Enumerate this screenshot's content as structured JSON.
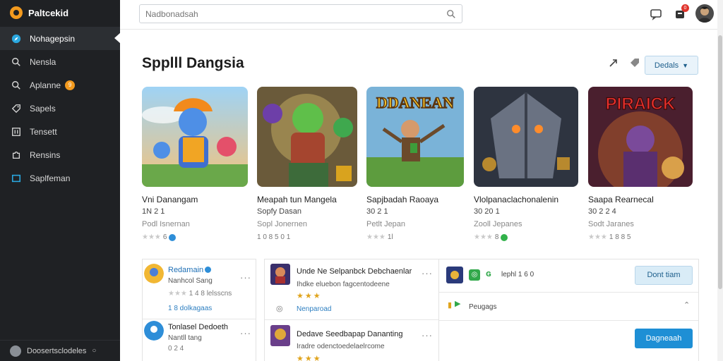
{
  "app": {
    "brand_name": "Paltcekid",
    "search_placeholder": "Nadbonadsah",
    "notification_count": "0",
    "accent": "#f39a1e",
    "primary": "#1e8fd5"
  },
  "sidebar": {
    "items": [
      {
        "label": "Nohagepsin",
        "icon": "compass-icon",
        "active": true
      },
      {
        "label": "Nensla",
        "icon": "search-icon"
      },
      {
        "label": "Aplanne",
        "icon": "search-icon",
        "badge": "9"
      },
      {
        "label": "Sapels",
        "icon": "tag-icon"
      },
      {
        "label": "Tensett",
        "icon": "grid-icon"
      },
      {
        "label": "Rensins",
        "icon": "puzzle-icon"
      },
      {
        "label": "Saplfeman",
        "icon": "window-icon"
      }
    ],
    "footer_label": "Doosertsclodeles"
  },
  "main": {
    "title": "Spplll Dangsia",
    "dropdown_label": "Dedals"
  },
  "cards": [
    {
      "title": "Vni Danangam",
      "sub": "1N 2 1",
      "dev": "Podl Isnernan",
      "rating": "6",
      "badge": "blue"
    },
    {
      "title": "Meapah tun Mangela",
      "sub": "Sopfy Dasan",
      "dev": "Sopl Jonernen",
      "rating": "1 0 8 5 0 1",
      "badge": "none"
    },
    {
      "title": "Sapjbadah Raoaya",
      "sub": "30 2 1",
      "dev": "Petlt Jepan",
      "rating": "1l",
      "badge": "none"
    },
    {
      "title": "Vlolpanaclachonalenin",
      "sub": "30 20 1",
      "dev": "Zooll Jepanes",
      "rating": "8",
      "badge": "green"
    },
    {
      "title": "Saapa Rearnecal",
      "sub": "30 2 2 4",
      "dev": "Sodt Jaranes",
      "rating": "1 8 8 5",
      "badge": "none"
    }
  ],
  "card_art_text": [
    "DDANEAN",
    "PIRAICK"
  ],
  "left_panel": [
    {
      "name": "Redamain",
      "sub": "Nanhcol Sang",
      "meta": "1 4 8 lelsscns",
      "link": "1 8 dolkagaas"
    },
    {
      "name": "Tonlasel Dedoeth",
      "sub": "Nantll tang",
      "meta": "0 2 4"
    }
  ],
  "mid_panel": [
    {
      "title": "Unde Ne Selpanbck Debchaenlar",
      "sub": "Ihdke eluebon fagcentodeene",
      "link": "Nenparoad"
    },
    {
      "title": "Dedave Seedbapap Dananting",
      "sub": "Iradre odenctoedelaelrcome"
    }
  ],
  "right_panel": {
    "row1_label": "lephl 1 6 0",
    "row1_button": "Dont tiam",
    "row2_label": "Peugags",
    "row3_button": "Dagneaah"
  }
}
